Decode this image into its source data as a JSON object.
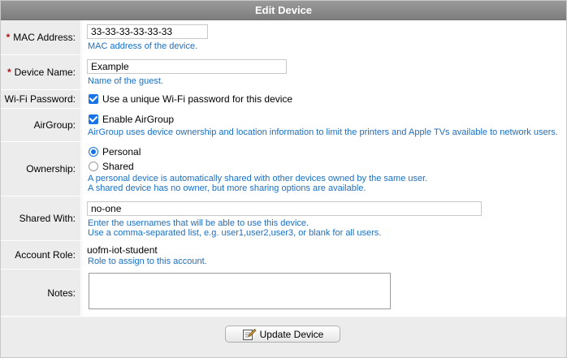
{
  "dialog": {
    "title": "Edit Device"
  },
  "fields": {
    "mac": {
      "label": "MAC Address:",
      "required_mark": "*",
      "value": "33-33-33-33-33-33",
      "help": "MAC address of the device."
    },
    "device_name": {
      "label": "Device Name:",
      "required_mark": "*",
      "value": "Example",
      "help": "Name of the guest."
    },
    "wifi_password": {
      "label": "Wi-Fi Password:",
      "checkbox_label": "Use a unique Wi-Fi password for this device",
      "checked": true
    },
    "airgroup": {
      "label": "AirGroup:",
      "checkbox_label": "Enable AirGroup",
      "checked": true,
      "help": "AirGroup uses device ownership and location information to limit the printers and Apple TVs available to network users."
    },
    "ownership": {
      "label": "Ownership:",
      "options": [
        {
          "label": "Personal",
          "selected": true
        },
        {
          "label": "Shared",
          "selected": false
        }
      ],
      "help_line1": "A personal device is automatically shared with other devices owned by the same user.",
      "help_line2": "A shared device has no owner, but more sharing options are available."
    },
    "shared_with": {
      "label": "Shared With:",
      "value": "no-one",
      "help_line1": "Enter the usernames that will be able to use this device.",
      "help_line2": "Use a comma-separated list, e.g. user1,user2,user3, or blank for all users."
    },
    "account_role": {
      "label": "Account Role:",
      "value": "uofm-iot-student",
      "help": "Role to assign to this account."
    },
    "notes": {
      "label": "Notes:",
      "value": ""
    }
  },
  "actions": {
    "update_label": "Update Device",
    "update_icon": "edit-document-icon"
  },
  "colors": {
    "title_bar": "#8a8a8a",
    "help_text": "#1a6fc4",
    "checkbox": "#1b73e8",
    "required": "#b01010"
  }
}
